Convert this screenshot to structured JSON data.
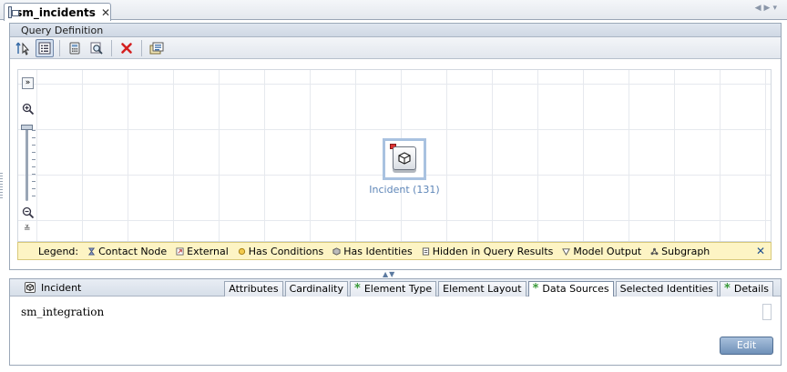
{
  "window": {
    "tab_title": "sm_incidents"
  },
  "query_definition": {
    "header": "Query Definition",
    "toolbar": {
      "icons": [
        "select-pointer-icon",
        "list-view-icon",
        "calculator-icon",
        "find-icon",
        "delete-icon",
        "properties-icon"
      ]
    },
    "node": {
      "label": "Incident (131)"
    }
  },
  "legend": {
    "title": "Legend:",
    "items": [
      {
        "label": "Contact Node",
        "icon": "contact-node-icon",
        "color": "#6a7fb8"
      },
      {
        "label": "External",
        "icon": "external-icon",
        "color": "#c0504d"
      },
      {
        "label": "Has Conditions",
        "icon": "has-conditions-icon",
        "color": "#d6a92b"
      },
      {
        "label": "Has Identities",
        "icon": "has-identities-icon",
        "color": "#707070"
      },
      {
        "label": "Hidden in Query Results",
        "icon": "hidden-icon",
        "color": "#555555"
      },
      {
        "label": "Model Output",
        "icon": "model-output-icon",
        "color": "#555555"
      },
      {
        "label": "Subgraph",
        "icon": "subgraph-icon",
        "color": "#555555"
      }
    ]
  },
  "details": {
    "element_name": "Incident",
    "tabs": [
      {
        "label": "Attributes",
        "star": false,
        "selected": false
      },
      {
        "label": "Cardinality",
        "star": false,
        "selected": false
      },
      {
        "label": "Element Type",
        "star": true,
        "selected": false
      },
      {
        "label": "Element Layout",
        "star": false,
        "selected": false
      },
      {
        "label": "Data Sources",
        "star": true,
        "selected": true
      },
      {
        "label": "Selected Identities",
        "star": false,
        "selected": false
      },
      {
        "label": "Details",
        "star": true,
        "selected": false
      }
    ],
    "data_source_value": "sm_integration",
    "star_glyph": "*"
  },
  "actions": {
    "edit_label": "Edit"
  }
}
